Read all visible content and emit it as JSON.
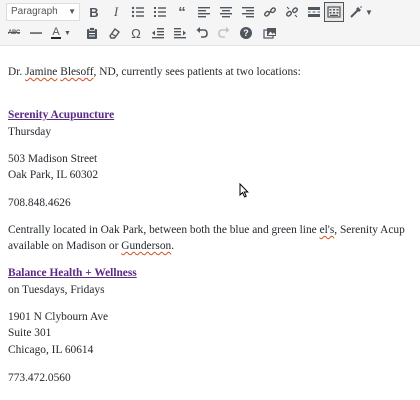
{
  "toolbar": {
    "format_select": "Paragraph",
    "row1_icons": [
      "bold-icon",
      "italic-icon",
      "bullet-list-icon",
      "numbered-list-icon",
      "blockquote-icon",
      "align-left-icon",
      "align-center-icon",
      "align-right-icon",
      "link-icon",
      "unlink-icon",
      "read-more-icon",
      "toolbar-toggle-icon",
      "paint-icon"
    ],
    "row2_icons": [
      "strikethrough-icon",
      "horizontal-line-icon",
      "text-color-icon",
      "paste-text-icon",
      "clear-formatting-icon",
      "special-character-icon",
      "outdent-icon",
      "indent-icon",
      "undo-icon",
      "redo-icon",
      "help-icon",
      "media-icon"
    ],
    "bold_label": "B",
    "italic_label": "I",
    "text_color_label": "A",
    "strike_label": "ABC",
    "help_label": "?",
    "omega_label": "Ω"
  },
  "content": {
    "intro_prefix": "Dr. ",
    "intro_name_1": "Jamine",
    "intro_mid": " ",
    "intro_name_2": "Blesoff",
    "intro_suffix": ", ND, currently sees patients at two locations:",
    "loc1": {
      "name": "Serenity Acupuncture",
      "days": "Thursday",
      "street": "503 Madison Street",
      "city": "Oak Park, IL 60302",
      "phone": "708.848.4626",
      "desc_1a": "Centrally located in Oak Park, between both the blue and green line ",
      "desc_1b": "el's",
      "desc_1c": ", Serenity Acup",
      "desc_2a": "available on Madison or ",
      "desc_2b": "Gunderson",
      "desc_2c": "."
    },
    "loc2": {
      "name": "Balance Health + Wellness",
      "days": "on Tuesdays, Fridays",
      "street": "1901 N Clybourn Ave",
      "suite": "Suite 301",
      "city": "Chicago, IL 60614",
      "phone": "773.472.0560"
    }
  }
}
